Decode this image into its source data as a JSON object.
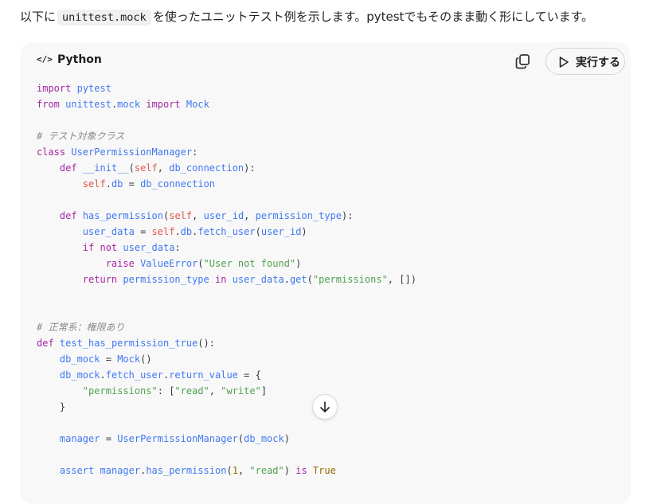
{
  "intro": {
    "before": "以下に",
    "code": "unittest.mock",
    "after": "を使ったユニットテスト例を示します。pytestでもそのまま動く形にしています。"
  },
  "code_block": {
    "icon": "code-icon",
    "language": "Python",
    "copy_icon": "copy-icon",
    "run_icon": "play-icon",
    "run_label": "実行する",
    "scroll_icon": "arrow-down-icon",
    "lines": [
      "import pytest",
      "from unittest.mock import Mock",
      "",
      "# テスト対象クラス",
      "class UserPermissionManager:",
      "    def __init__(self, db_connection):",
      "        self.db = db_connection",
      "",
      "    def has_permission(self, user_id, permission_type):",
      "        user_data = self.db.fetch_user(user_id)",
      "        if not user_data:",
      "            raise ValueError(\"User not found\")",
      "        return permission_type in user_data.get(\"permissions\", [])",
      "",
      "",
      "# 正常系：権限あり",
      "def test_has_permission_true():",
      "    db_mock = Mock()",
      "    db_mock.fetch_user.return_value = {",
      "        \"permissions\": [\"read\", \"write\"]",
      "    }",
      "",
      "    manager = UserPermissionManager(db_mock)",
      "",
      "    assert manager.has_permission(1, \"read\") is True"
    ]
  }
}
